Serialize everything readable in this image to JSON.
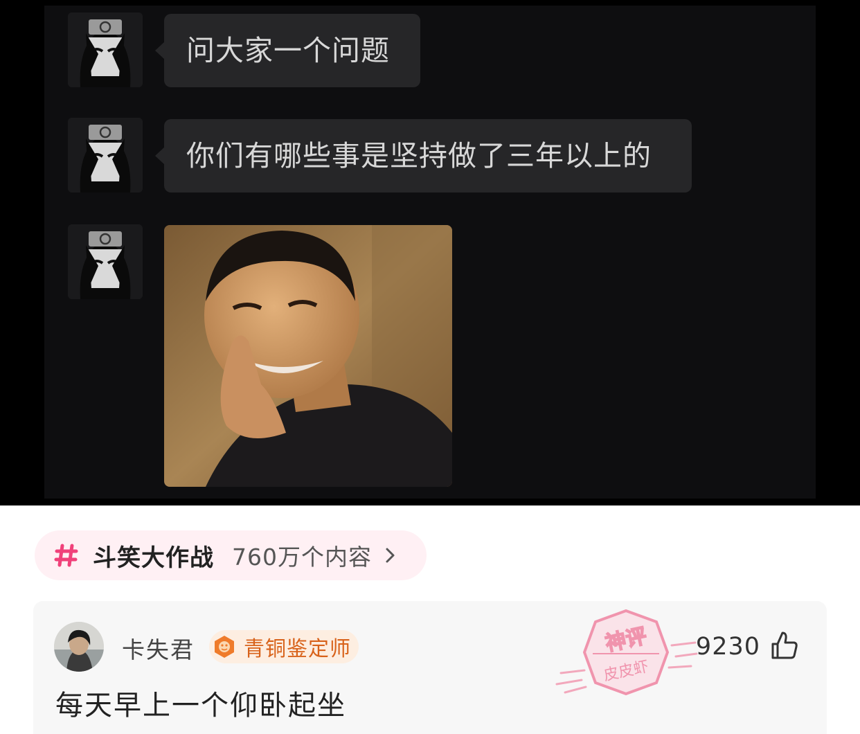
{
  "chat": {
    "messages": [
      {
        "type": "text",
        "text": "问大家一个问题"
      },
      {
        "type": "text",
        "text": "你们有哪些事是坚持做了三年以上的"
      },
      {
        "type": "image",
        "icon": "meme-photo"
      }
    ],
    "avatar_icon": "ninja-avatar-icon"
  },
  "topic": {
    "icon": "hash-icon",
    "name": "斗笑大作战",
    "count": "760万个内容"
  },
  "comment": {
    "username": "卡失君",
    "badge": "青铜鉴定师",
    "text": "每天早上一个仰卧起坐",
    "likes": "9230",
    "watermark": {
      "line1": "神评",
      "line2": "皮皮虾"
    }
  },
  "colors": {
    "chat_bg": "#0e0e10",
    "bubble_bg": "#262628",
    "topic_accent": "#f0417a",
    "badge_text": "#d8621a",
    "watermark": "#f08aa6"
  }
}
